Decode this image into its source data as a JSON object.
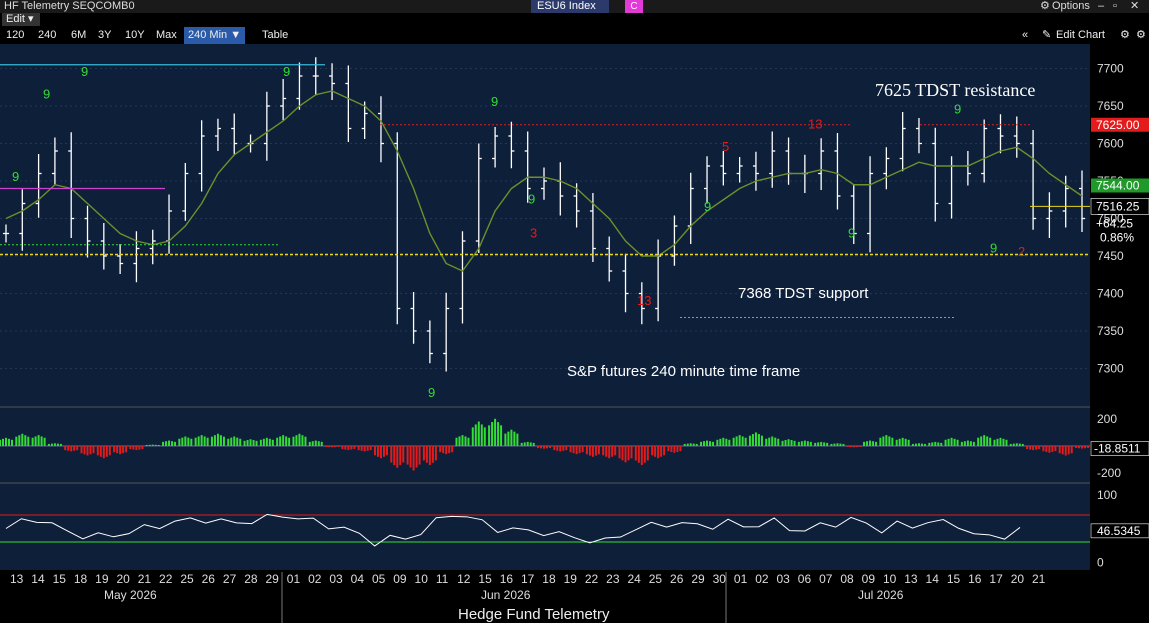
{
  "window": {
    "title": "HF Telemetry SEQCOMB0",
    "ticker": "ESU6 Index",
    "ticker_box": "C",
    "options_label": "Options"
  },
  "edit_label": "Edit",
  "toolbar": {
    "ranges": [
      "120",
      "240",
      "6M",
      "3Y",
      "10Y",
      "Max"
    ],
    "active_range": "240 Min",
    "table_label": "Table",
    "edit_chart_label": "Edit Chart"
  },
  "chart_data": [
    {
      "type": "candlestick",
      "title": "",
      "annotations": [
        "7625 TDST resistance",
        "7368 TDST support",
        "S&P futures 240 minute time frame"
      ],
      "ylim": [
        7250,
        7730
      ],
      "yticks": [
        7300,
        7350,
        7400,
        7450,
        7500,
        7550,
        7600,
        7650,
        7700
      ],
      "price_labels": [
        {
          "text": "7625.00",
          "value": 7625,
          "color": "#e31b1b"
        },
        {
          "text": "7544.00",
          "value": 7544,
          "color": "#1f9a2a"
        },
        {
          "text": "7516.25",
          "value": 7516.25,
          "color": "#ffffff"
        }
      ],
      "last_price": "7516.25",
      "change": "+64.25",
      "change_pct": "0.86%",
      "series": [
        {
          "name": "",
          "kind": "bars",
          "close": [
            7480,
            7520,
            7560,
            7590,
            7500,
            7470,
            7450,
            7440,
            7460,
            7470,
            7510,
            7560,
            7610,
            7620,
            7600,
            7600,
            7650,
            7660,
            7690,
            7690,
            7680,
            7620,
            7640,
            7600,
            7380,
            7350,
            7320,
            7380,
            7470,
            7580,
            7610,
            7590,
            7540,
            7550,
            7530,
            7510,
            7460,
            7430,
            7400,
            7380,
            7450,
            7490,
            7540,
            7570,
            7560,
            7570,
            7560,
            7590,
            7560,
            7560,
            7590,
            7530,
            7480,
            7560,
            7580,
            7620,
            7600,
            7520,
            7570,
            7560,
            7620,
            7610,
            7600,
            7500,
            7510,
            7540,
            7500
          ]
        },
        {
          "name": "",
          "kind": "moving-average",
          "values": [
            7500,
            7510,
            7525,
            7545,
            7540,
            7520,
            7500,
            7480,
            7470,
            7465,
            7470,
            7490,
            7520,
            7560,
            7585,
            7600,
            7615,
            7630,
            7650,
            7665,
            7670,
            7660,
            7650,
            7630,
            7590,
            7540,
            7480,
            7440,
            7430,
            7460,
            7510,
            7540,
            7555,
            7555,
            7550,
            7540,
            7520,
            7500,
            7470,
            7450,
            7450,
            7465,
            7490,
            7510,
            7525,
            7540,
            7550,
            7555,
            7560,
            7560,
            7565,
            7560,
            7545,
            7545,
            7555,
            7565,
            7575,
            7570,
            7570,
            7570,
            7580,
            7590,
            7595,
            7580,
            7560,
            7545,
            7530
          ]
        }
      ]
    },
    {
      "type": "bar",
      "title": "",
      "ylim": [
        -250,
        250
      ],
      "yticks": [
        200,
        -200
      ],
      "last_value": "-18.8511",
      "values": [
        60,
        90,
        80,
        20,
        -40,
        -70,
        -90,
        -60,
        -30,
        10,
        40,
        70,
        80,
        90,
        70,
        50,
        60,
        80,
        90,
        40,
        -10,
        -30,
        -40,
        -90,
        -160,
        -180,
        -140,
        -60,
        80,
        180,
        200,
        120,
        30,
        -20,
        -40,
        -60,
        -80,
        -90,
        -120,
        -140,
        -90,
        -50,
        20,
        40,
        60,
        80,
        100,
        70,
        50,
        40,
        30,
        20,
        -10,
        40,
        80,
        60,
        20,
        30,
        60,
        40,
        80,
        60,
        20,
        -30,
        -50,
        -70,
        -18.85
      ]
    },
    {
      "type": "line",
      "title": "",
      "ylim": [
        -10,
        110
      ],
      "yticks": [
        100,
        0
      ],
      "last_value": "46.5345",
      "levels": [
        70,
        30
      ],
      "values": [
        50,
        60,
        65,
        55,
        45,
        40,
        38,
        40,
        45,
        50,
        55,
        60,
        62,
        64,
        60,
        58,
        62,
        65,
        70,
        66,
        60,
        55,
        50,
        40,
        30,
        35,
        35,
        45,
        60,
        72,
        68,
        58,
        50,
        48,
        46,
        45,
        40,
        38,
        32,
        30,
        42,
        48,
        55,
        58,
        55,
        56,
        54,
        58,
        55,
        55,
        60,
        52,
        45,
        55,
        58,
        62,
        58,
        48,
        55,
        54,
        60,
        58,
        56,
        40,
        38,
        40,
        46.53
      ]
    }
  ],
  "x_axis": {
    "dates": [
      "13",
      "14",
      "15",
      "18",
      "19",
      "20",
      "21",
      "22",
      "25",
      "26",
      "27",
      "28",
      "29",
      "01",
      "02",
      "03",
      "04",
      "05",
      "09",
      "10",
      "11",
      "12",
      "15",
      "16",
      "17",
      "18",
      "19",
      "22",
      "23",
      "24",
      "25",
      "26",
      "29",
      "30",
      "01",
      "02",
      "03",
      "06",
      "07",
      "08",
      "09",
      "10",
      "13",
      "14",
      "15",
      "16",
      "17",
      "20",
      "21"
    ],
    "months": [
      "May 2026",
      "Jun 2026",
      "Jul 2026"
    ],
    "footer": "Hedge Fund Telemetry"
  },
  "colors": {
    "background": "#12233f",
    "bars": "#ffffff",
    "ma": "#6e8f2a",
    "setup_up": "#33dd33",
    "setup_down": "#e31b1b",
    "tdst_resistance": "#e31b1b",
    "tdst_support": "#33dd33",
    "price_line": "#e8d41a",
    "rsi_upper": "#e31b1b",
    "rsi_lower": "#33dd33"
  }
}
